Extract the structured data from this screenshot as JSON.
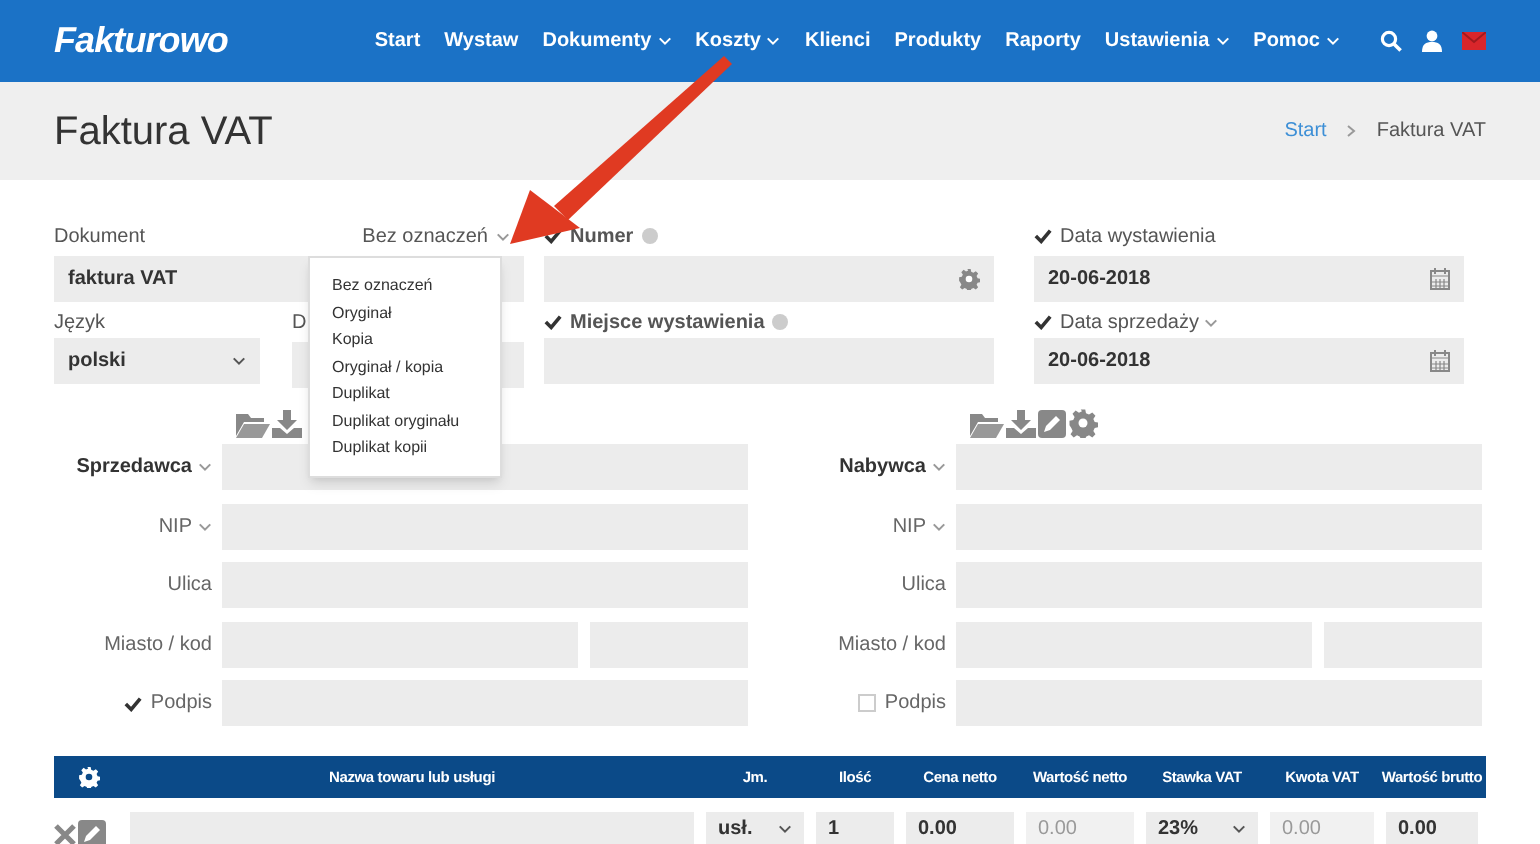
{
  "header": {
    "logo": "Fakturowo",
    "nav": [
      {
        "label": "Start",
        "dropdown": false
      },
      {
        "label": "Wystaw",
        "dropdown": false
      },
      {
        "label": "Dokumenty",
        "dropdown": true
      },
      {
        "label": "Koszty",
        "dropdown": true
      },
      {
        "label": "Klienci",
        "dropdown": false
      },
      {
        "label": "Produkty",
        "dropdown": false
      },
      {
        "label": "Raporty",
        "dropdown": false
      },
      {
        "label": "Ustawienia",
        "dropdown": true
      },
      {
        "label": "Pomoc",
        "dropdown": true
      }
    ]
  },
  "page_title": "Faktura VAT",
  "breadcrumb": [
    {
      "label": "Start",
      "link": true
    },
    {
      "label": "Faktura VAT",
      "link": false
    }
  ],
  "document": {
    "label": "Dokument",
    "value": "faktura VAT",
    "marking": "Bez oznaczeń",
    "marking_menu": [
      "Bez oznaczeń",
      "Oryginał",
      "Kopia",
      "Oryginał / kopia",
      "Duplikat",
      "Duplikat oryginału",
      "Duplikat kopii"
    ]
  },
  "number": {
    "label": "Numer",
    "checked": true
  },
  "issue_date": {
    "label": "Data wystawienia",
    "checked": true,
    "value": "20-06-2018"
  },
  "language": {
    "label": "Język",
    "value": "polski"
  },
  "column_2_label": "D",
  "place": {
    "label": "Miejsce wystawienia",
    "checked": true
  },
  "sale_date": {
    "label": "Data sprzedaży",
    "checked": true,
    "value": "20-06-2018"
  },
  "parties": [
    {
      "label": "Sprzedawca",
      "signature_checked": true,
      "icons": [
        {
          "kind": "folder"
        },
        {
          "kind": "download"
        }
      ],
      "rows": [
        {
          "label": "NIP",
          "dropdown": true,
          "kind": "field"
        },
        {
          "label": "Ulica",
          "dropdown": false,
          "kind": "field"
        },
        {
          "label": "Miasto / kod",
          "dropdown": false,
          "kind": "split"
        },
        {
          "label": "Podpis",
          "dropdown": false,
          "kind": "signature"
        }
      ]
    },
    {
      "label": "Nabywca",
      "signature_checked": false,
      "icons": [
        {
          "kind": "folder"
        },
        {
          "kind": "download"
        },
        {
          "kind": "edit"
        },
        {
          "kind": "gear"
        }
      ],
      "rows": [
        {
          "label": "NIP",
          "dropdown": true,
          "kind": "field"
        },
        {
          "label": "Ulica",
          "dropdown": false,
          "kind": "field"
        },
        {
          "label": "Miasto / kod",
          "dropdown": false,
          "kind": "split"
        },
        {
          "label": "Podpis",
          "dropdown": false,
          "kind": "signature"
        }
      ]
    }
  ],
  "table": {
    "columns": [
      "Nazwa towaru lub usługi",
      "Jm.",
      "Ilość",
      "Cena netto",
      "Wartość netto",
      "Stawka VAT",
      "Kwota VAT",
      "Wartość brutto"
    ],
    "row": [
      {
        "kind": "field"
      },
      {
        "kind": "select",
        "value": "usł.",
        "readonly": false
      },
      {
        "kind": "field",
        "value": "1",
        "readonly": false
      },
      {
        "kind": "field",
        "value": "0.00",
        "readonly": false
      },
      {
        "kind": "field",
        "value": "0.00",
        "readonly": true
      },
      {
        "kind": "select",
        "value": "23%",
        "readonly": false
      },
      {
        "kind": "field",
        "value": "0.00",
        "readonly": true
      },
      {
        "kind": "field",
        "value": "0.00",
        "readonly": false
      }
    ]
  }
}
